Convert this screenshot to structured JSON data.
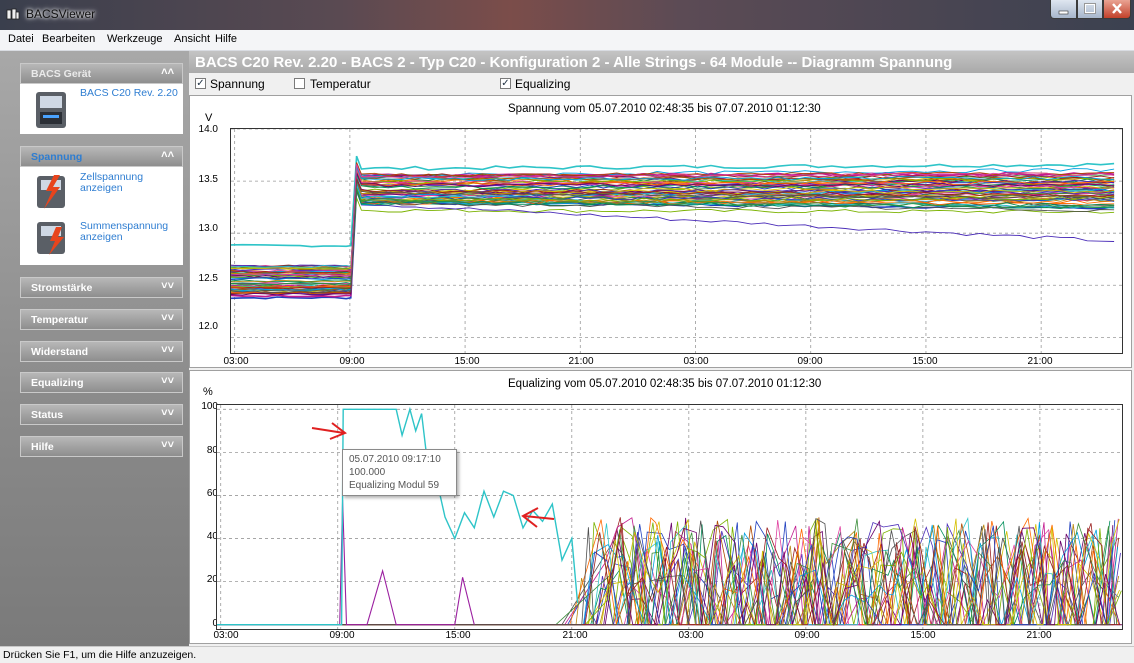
{
  "window": {
    "title": "BACSViewer"
  },
  "menu": [
    "Datei",
    "Bearbeiten",
    "Werkzeuge",
    "Ansicht",
    "Hilfe"
  ],
  "sidebar": {
    "device_header": "BACS Gerät",
    "device_link": "BACS C20 Rev. 2.20",
    "spannung_header": "Spannung",
    "zell_link_1": "Zellspannung",
    "zell_link_2": "anzeigen",
    "summen_link_1": "Summenspannung",
    "summen_link_2": "anzeigen",
    "items": [
      "Stromstärke",
      "Temperatur",
      "Widerstand",
      "Equalizing",
      "Status",
      "Hilfe"
    ]
  },
  "header": {
    "title": "BACS C20 Rev. 2.20 - BACS 2 - Typ C20 - Konfiguration 2 - Alle Strings - 64 Module -- Diagramm Spannung"
  },
  "options": [
    {
      "label": "Spannung",
      "checked": true,
      "mark": "✓"
    },
    {
      "label": "Temperatur",
      "checked": false,
      "mark": ""
    },
    {
      "label": "Equalizing",
      "checked": true,
      "mark": "✓"
    }
  ],
  "status": {
    "text": "Drücken Sie F1, um die Hilfe anzuzeigen."
  },
  "tooltip": {
    "line1": "05.07.2010 09:17:10",
    "line2": "100.000",
    "line3": "Equalizing Modul 59"
  },
  "colors": {
    "accent_link": "#2e7dd1",
    "series_cyan": "#2ec4c8",
    "arrow_red": "#e02020"
  },
  "chart_data": [
    {
      "type": "line",
      "title": "Spannung vom 05.07.2010 02:48:35 bis 07.07.2010 01:12:30",
      "ylabel": "V",
      "yticks": [
        "14.0",
        "13.5",
        "13.0",
        "12.5",
        "12.0"
      ],
      "ylim": [
        11.85,
        14.0
      ],
      "xticks": [
        "03:00",
        "09:00",
        "15:00",
        "21:00",
        "03:00",
        "09:00",
        "15:00",
        "21:00"
      ],
      "xlim_hours": [
        2.81,
        49.21
      ],
      "grid": true,
      "series_count": 64,
      "summary": {
        "before_09": {
          "min": 12.37,
          "max": 12.9
        },
        "after_09": {
          "min": 13.2,
          "max": 13.65
        },
        "lowest_series_end": 12.92
      }
    },
    {
      "type": "line",
      "title": "Equalizing vom 05.07.2010 02:48:35 bis 07.07.2010 01:12:30",
      "ylabel": "%",
      "yticks": [
        "100",
        "80",
        "60",
        "40",
        "20",
        "0"
      ],
      "ylim": [
        -2,
        102
      ],
      "xticks": [
        "03:00",
        "09:00",
        "15:00",
        "21:00",
        "03:00",
        "09:00",
        "15:00",
        "21:00"
      ],
      "xlim_hours": [
        2.81,
        49.21
      ],
      "grid": true,
      "series_count": 64,
      "highlight": {
        "name": "Equalizing Modul 59",
        "x": [
          2.81,
          9.2,
          9.28,
          12.0,
          12.3,
          12.7,
          13.0,
          13.3,
          13.6,
          14.0,
          14.5,
          15.0,
          15.5,
          16.0,
          16.5,
          17.0,
          17.5,
          18.0,
          18.5,
          19.0,
          19.5,
          20.0,
          20.5,
          21.0,
          21.3
        ],
        "y": [
          0,
          0,
          100,
          100,
          88,
          100,
          90,
          98,
          75,
          70,
          50,
          40,
          52,
          45,
          62,
          50,
          62,
          60,
          45,
          53,
          48,
          56,
          30,
          40,
          10
        ]
      }
    }
  ]
}
